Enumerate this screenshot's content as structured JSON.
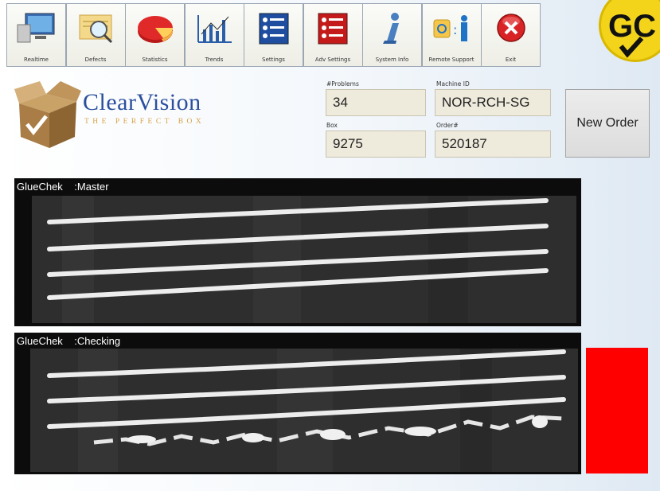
{
  "toolbar": {
    "buttons": [
      {
        "label": "Realtime",
        "icon": "monitor-icon"
      },
      {
        "label": "Defects",
        "icon": "magnifier-icon"
      },
      {
        "label": "Statistics",
        "icon": "pie-chart-icon"
      },
      {
        "label": "Trends",
        "icon": "trend-chart-icon"
      },
      {
        "label": "Settings",
        "icon": "settings-list-icon"
      },
      {
        "label": "Adv Settings",
        "icon": "advanced-settings-icon"
      },
      {
        "label": "System Info",
        "icon": "info-icon"
      },
      {
        "label": "Remote Support",
        "icon": "remote-support-icon"
      },
      {
        "label": "Exit",
        "icon": "close-icon"
      }
    ]
  },
  "badge": {
    "text": "GC",
    "icon": "checkmark-icon",
    "color": "#f4d41b"
  },
  "logo": {
    "name": "ClearVision",
    "tagline": "THE PERFECT BOX",
    "icon": "box-logo-icon"
  },
  "fields": {
    "problems": {
      "label": "#Problems",
      "value": "34"
    },
    "machine_id": {
      "label": "Machine ID",
      "value": "NOR-RCH-SG"
    },
    "box": {
      "label": "Box",
      "value": "9275"
    },
    "order": {
      "label": "Order#",
      "value": "520187"
    }
  },
  "new_order_label": "New Order",
  "panels": {
    "master": {
      "title": "GlueChek    :Master"
    },
    "checking": {
      "title": "GlueChek    :Checking"
    }
  },
  "status": {
    "color": "#ff0000"
  }
}
